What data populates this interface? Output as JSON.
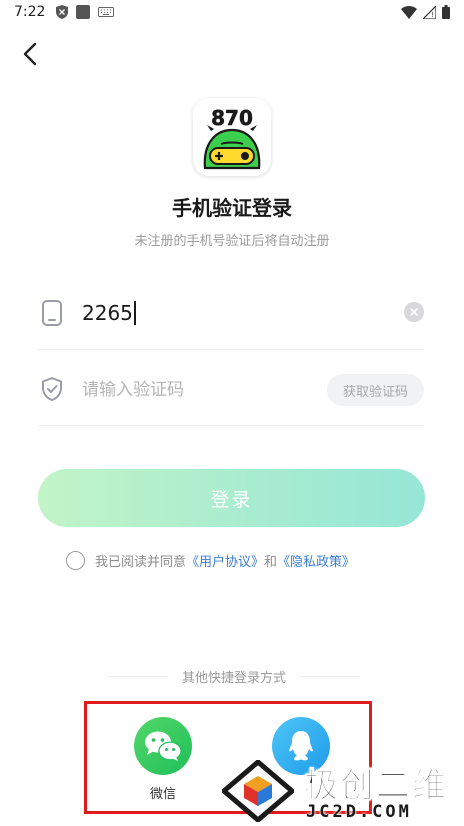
{
  "status_bar": {
    "time": "7:22",
    "left_icons": [
      "shield-icon",
      "square-notification-icon",
      "keyboard-icon"
    ],
    "right_icons": [
      "wifi-icon",
      "signal-icon",
      "battery-icon"
    ]
  },
  "header": {
    "back_icon": "back-arrow-icon"
  },
  "app": {
    "logo_text": "870",
    "title": "手机验证登录",
    "subtitle": "未注册的手机号验证后将自动注册"
  },
  "form": {
    "phone": {
      "value": "2265",
      "icon": "phone-icon",
      "clear_icon": "clear-icon"
    },
    "code": {
      "placeholder": "请输入验证码",
      "icon": "shield-check-icon",
      "get_code_label": "获取验证码"
    },
    "login_label": "登录"
  },
  "agreement": {
    "prefix": "我已阅读并同意",
    "user_agreement": "《用户协议》",
    "and": "和",
    "privacy_policy": "《隐私政策》"
  },
  "other_login": {
    "label": "其他快捷登录方式",
    "wechat_label": "微信",
    "highlight_color": "#e01b1b"
  },
  "watermark": {
    "brand": "极创二维",
    "domain": "JC2D.COM"
  },
  "colors": {
    "login_gradient_start": "#c2f4c7",
    "login_gradient_end": "#96e6d6",
    "link": "#3b7fd4",
    "wechat": "#1fbf5a",
    "qq": "#1e9be8"
  }
}
